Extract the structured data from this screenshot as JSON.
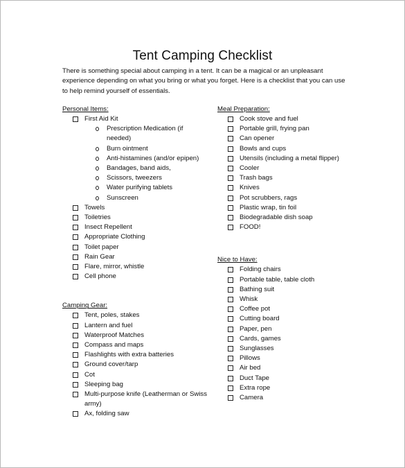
{
  "document": {
    "title": "Tent Camping Checklist",
    "intro": "There is something special about camping in a tent.  It can be a magical or an unpleasant experience depending on what you bring or what you forget.  Here is a checklist that you can use to help remind yourself of essentials."
  },
  "personal": {
    "heading": "Personal Items:",
    "first_aid": {
      "label": "First Aid Kit",
      "sub": [
        "Prescription Medication (if needed)",
        "Burn ointment",
        "Anti-histamines (and/or epipen)",
        "Bandages, band aids,",
        "Scissors, tweezers",
        "Water purifying tablets",
        "Sunscreen"
      ]
    },
    "items": [
      "Towels",
      "Toiletries",
      "Insect Repellent",
      "Appropriate Clothing",
      "Toilet paper",
      "Rain Gear",
      "Flare, mirror, whistle",
      "Cell phone"
    ]
  },
  "camping_gear": {
    "heading": "Camping Gear:",
    "items": [
      "Tent, poles, stakes",
      "Lantern and fuel",
      "Waterproof Matches",
      "Compass and maps",
      "Flashlights with extra batteries",
      "Ground cover/tarp",
      "Cot",
      "Sleeping bag",
      "Multi-purpose knife (Leatherman or Swiss army)",
      "Ax, folding saw"
    ]
  },
  "meal_prep": {
    "heading": "Meal Preparation:",
    "items": [
      "Cook stove and fuel",
      "Portable grill, frying pan",
      "Can opener",
      "Bowls and cups",
      "Utensils (including a metal flipper)",
      "Cooler",
      "Trash bags",
      "Knives",
      "Pot scrubbers, rags",
      "Plastic wrap, tin foil",
      "Biodegradable dish soap",
      "FOOD!"
    ]
  },
  "nice_to_have": {
    "heading": "Nice to Have:",
    "items": [
      "Folding chairs",
      "Portable table, table cloth",
      "Bathing suit",
      "Whisk",
      "Coffee pot",
      "Cutting board",
      "Paper, pen",
      "Cards, games",
      "Sunglasses",
      "Pillows",
      "Air bed",
      "Duct Tape",
      "Extra rope",
      "Camera"
    ]
  },
  "icons": {
    "checkbox": "empty-square-checkbox",
    "sub_bullet": "hollow-circle-bullet"
  }
}
